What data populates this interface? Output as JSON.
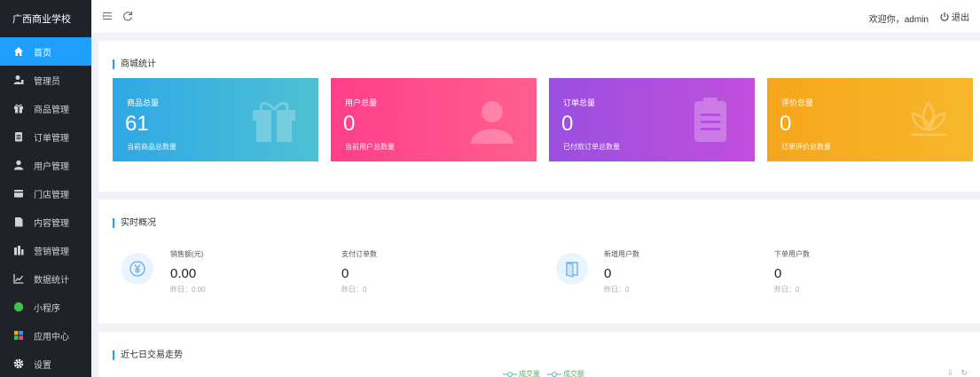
{
  "brand": "广西商业学校",
  "nav": [
    {
      "label": "首页",
      "icon": "home-icon",
      "active": true
    },
    {
      "label": "管理员",
      "icon": "admin-user-icon"
    },
    {
      "label": "商品管理",
      "icon": "gift-icon"
    },
    {
      "label": "订单管理",
      "icon": "order-icon"
    },
    {
      "label": "用户管理",
      "icon": "user-icon"
    },
    {
      "label": "门店管理",
      "icon": "store-icon"
    },
    {
      "label": "内容管理",
      "icon": "document-icon"
    },
    {
      "label": "营销管理",
      "icon": "marketing-icon"
    },
    {
      "label": "数据统计",
      "icon": "chart-line-icon"
    },
    {
      "label": "小程序",
      "icon": "miniprogram-icon"
    },
    {
      "label": "应用中心",
      "icon": "apps-icon"
    },
    {
      "label": "设置",
      "icon": "gear-icon"
    }
  ],
  "topbar": {
    "welcome": "欢迎你，admin",
    "logout": "退出"
  },
  "mall_stats": {
    "title": "商城统计",
    "cards": [
      {
        "label": "商品总量",
        "value": "61",
        "sub": "当前商品总数量",
        "icon": "gift-icon"
      },
      {
        "label": "用户总量",
        "value": "0",
        "sub": "当前用户总数量",
        "icon": "user-icon"
      },
      {
        "label": "订单总量",
        "value": "0",
        "sub": "已付款订单总数量",
        "icon": "order-icon"
      },
      {
        "label": "评价总量",
        "value": "0",
        "sub": "订单评价总数量",
        "icon": "flower-icon"
      }
    ]
  },
  "realtime": {
    "title": "实时概况",
    "items": [
      {
        "label": "销售额(元)",
        "value": "0.00",
        "sub": "昨日：0.00"
      },
      {
        "label": "支付订单数",
        "value": "0",
        "sub": "昨日：0"
      },
      {
        "label": "新增用户数",
        "value": "0",
        "sub": "昨日：0"
      },
      {
        "label": "下单用户数",
        "value": "0",
        "sub": "昨日：0"
      }
    ]
  },
  "trend": {
    "title": "近七日交易走势",
    "legend": [
      "成交量",
      "成交额"
    ]
  },
  "colors": {
    "sidebar": "#20222a",
    "accent": "#1e9fff",
    "card1": "#2fa8e6",
    "card2": "#ff3e8a",
    "card3": "#a34fe0",
    "card4": "#f6a61c"
  }
}
